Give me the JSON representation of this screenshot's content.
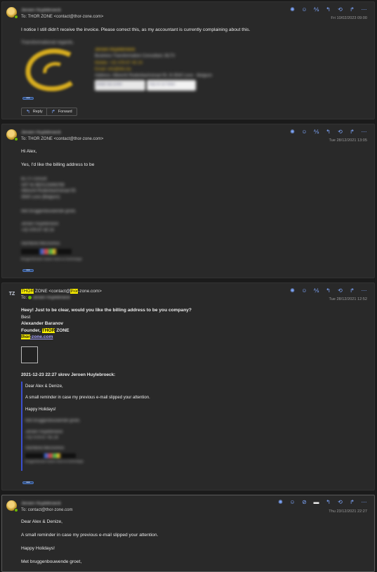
{
  "messages": [
    {
      "sender": "Jeroen Huylebroeck",
      "to_prefix": "To:",
      "to": "THOR ZONE <contact@thor-zone.com>",
      "time": "Fri 10/02/2023 09:00",
      "body": "I notice I still didn't receive the invoice. Please correct this, as my accountant is currently complaining about this.",
      "signature_greeting": "Transformational regards,",
      "signature_name": "Jeroen Huylebroeck",
      "signature_title": "Business Transformation Consultant, BLTX",
      "signature_mobile": "Mobile: +32 478 67 45 24",
      "signature_email": "Email: info@bltx.be",
      "signature_address": "Address: Albrecht Rodenbachstraat 55, B-3540 Leve - Belgium",
      "signature_badge_1": "Bekijk mijn profiel",
      "signature_badge_2": "Volg me op Twitter",
      "more": "•••",
      "reply_label": "Reply",
      "forward_label": "Forward"
    },
    {
      "sender": "Jeroen Huylebroeck",
      "to_prefix": "To:",
      "to": "THOR ZONE <contact@thor-zone.com>",
      "time": "Tue 28/12/2021 13:05",
      "greeting": "Hi Alex,",
      "body": "Yes, I'd like the billing address to be",
      "addr_1": "BLTX Consult",
      "addr_2": "VAT Nr BE0123456789",
      "addr_3": "Albrecht Rodenbachstraat 55",
      "addr_4": "3540 Leve (Belgium)",
      "closing": "Met bruggenbouwende groet,",
      "name": "Jeroen Huylebroeck",
      "phone": "+32 478 67 45 24",
      "tag": "Slichtend Microsmos",
      "footer": "Bruggenbouwer tussen mens en technologie",
      "more": "•••"
    },
    {
      "avatar": "TZ",
      "sender_hl": "THOR",
      "sender_rest": " ZONE <contact@",
      "sender_hl2": "thor",
      "sender_rest2": "-zone.com>",
      "to_prefix": "To:",
      "to": "Jeroen Huylebroeck",
      "time": "Tue 28/12/2021 12:52",
      "body": "Heey! Just to be clear, would you like the billing address to be you company?",
      "best": "Best",
      "name": "Alexander Baranov",
      "role_pre": "Founder, ",
      "role_hl": "THOR",
      "role_post": " ZONE",
      "site_hl": "thor",
      "site_rest": "-zone.com",
      "quote_header": "2021-12-23 22:27 skrev Jeroen Huylebroeck:",
      "q_greeting": "Dear Alex & Denize,",
      "q_body": "A small reminder in case my previous e-mail slipped your attention.",
      "q_holidays": "Happy Holidays!",
      "q_closing": "Met bruggenbouwende groet,",
      "q_name": "Jeroen Huylebroeck",
      "q_phone": "+32 478 67 45 24",
      "q_tag": "Slichtend Microsmos",
      "q_footer": "Bruggenbouwer tussen mens en technologie",
      "more": "•••"
    },
    {
      "sender": "Jeroen Huylebroeck",
      "to_prefix": "To:",
      "to": "contact@thor-zone.com",
      "time": "Thu 23/12/2021 22:27",
      "greeting": "Dear Alex & Denize,",
      "body": "A small reminder in case my previous e-mail slipped your attention.",
      "holidays": "Happy Holidays!",
      "closing": "Met bruggenbouwende groet,"
    }
  ],
  "colors": {
    "accent": "#7fa8ff",
    "highlight": "#fff200",
    "presence": "#6bb700"
  }
}
